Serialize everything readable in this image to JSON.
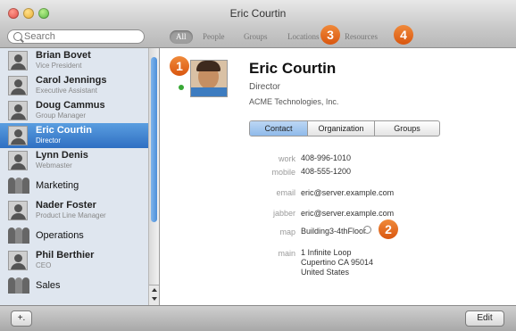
{
  "window": {
    "title": "Eric Courtin"
  },
  "search": {
    "placeholder": "Search"
  },
  "scopes": [
    "All",
    "People",
    "Groups",
    "Locations",
    "Resources"
  ],
  "callouts": [
    "1",
    "2",
    "3",
    "4"
  ],
  "contacts": [
    {
      "name": "Brian Bovet",
      "subtitle": "Vice President",
      "kind": "person"
    },
    {
      "name": "Carol Jennings",
      "subtitle": "Executive Assistant",
      "kind": "person"
    },
    {
      "name": "Doug Cammus",
      "subtitle": "Group Manager",
      "kind": "person"
    },
    {
      "name": "Eric Courtin",
      "subtitle": "Director",
      "kind": "person",
      "selected": true
    },
    {
      "name": "Lynn Denis",
      "subtitle": "Webmaster",
      "kind": "person"
    },
    {
      "name": "Marketing",
      "subtitle": "",
      "kind": "group"
    },
    {
      "name": "Nader Foster",
      "subtitle": "Product Line Manager",
      "kind": "person"
    },
    {
      "name": "Operations",
      "subtitle": "",
      "kind": "group"
    },
    {
      "name": "Phil Berthier",
      "subtitle": "CEO",
      "kind": "person"
    },
    {
      "name": "Sales",
      "subtitle": "",
      "kind": "group"
    }
  ],
  "person": {
    "name": "Eric Courtin",
    "title": "Director",
    "company": "ACME Technologies, Inc.",
    "fields": [
      {
        "label": "work",
        "value": "408-996-1010"
      },
      {
        "label": "mobile",
        "value": "408-555-1200"
      },
      {
        "label": "email",
        "value": "eric@server.example.com"
      },
      {
        "label": "jabber",
        "value": "eric@server.example.com"
      },
      {
        "label": "map",
        "value": "Building3-4thFloor"
      },
      {
        "label": "main",
        "value": "1 Infinite Loop"
      }
    ],
    "address_lines": [
      "Cupertino CA 95014",
      "United States"
    ]
  },
  "detail_tabs": [
    "Contact",
    "Organization",
    "Groups"
  ],
  "bottom": {
    "add_label": "+.",
    "edit_label": "Edit"
  },
  "colors": {
    "selection": "#3a7fd0",
    "sidebar": "#dfe6ef",
    "callout": "#e36d24",
    "presence": "#38a835"
  }
}
